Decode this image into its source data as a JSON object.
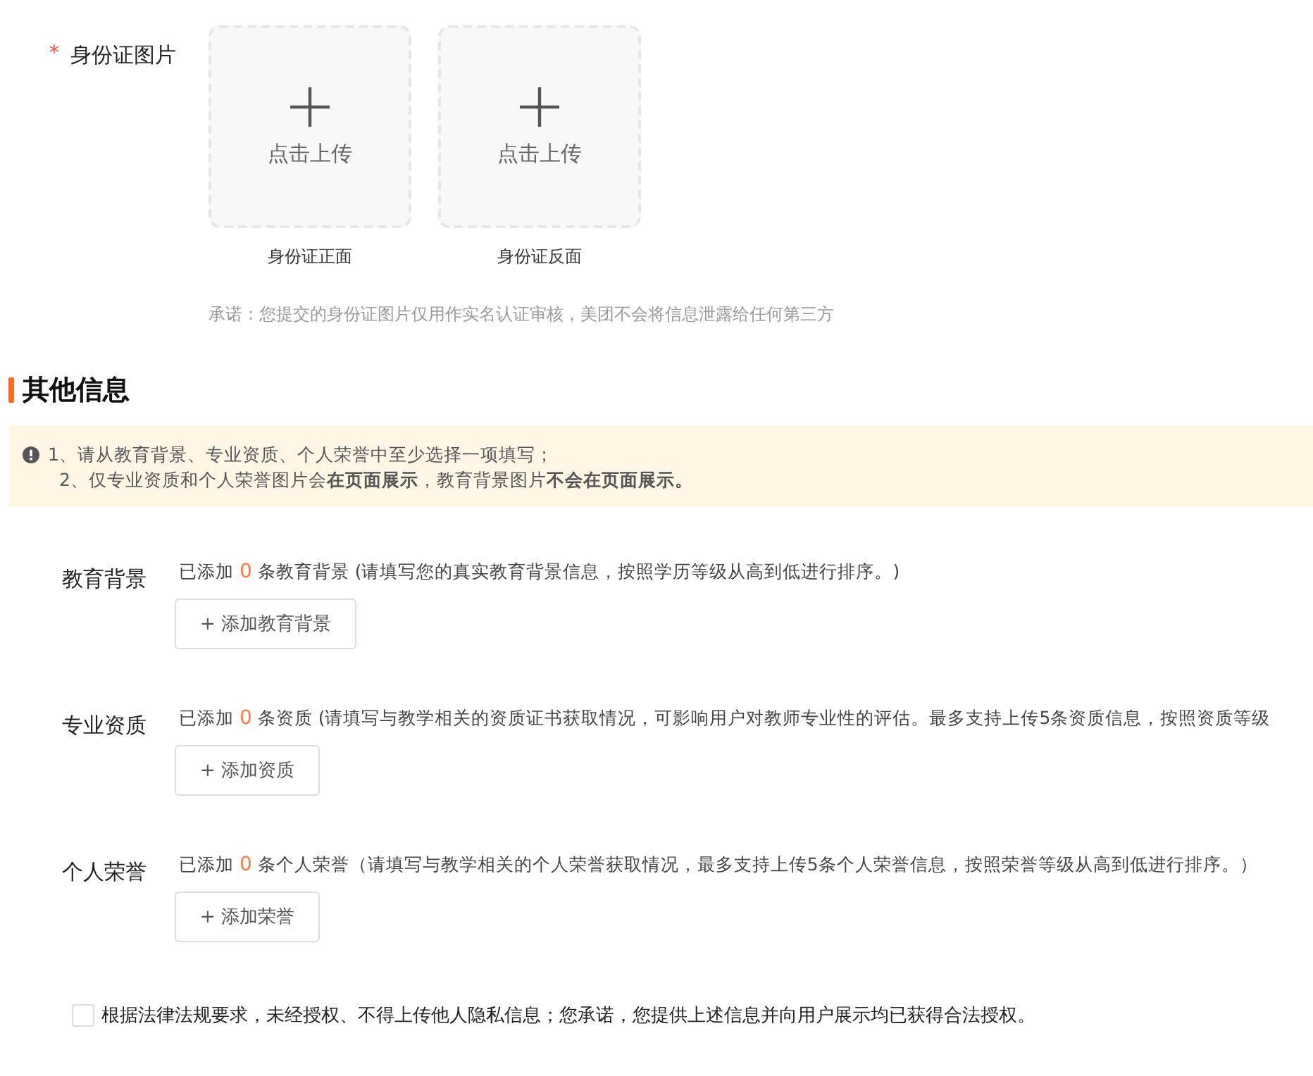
{
  "id_photo": {
    "required_mark": "*",
    "label": "身份证图片",
    "uploads": [
      {
        "text": "点击上传",
        "caption": "身份证正面"
      },
      {
        "text": "点击上传",
        "caption": "身份证反面"
      }
    ],
    "note": "承诺：您提交的身份证图片仅用作实名认证审核，美团不会将信息泄露给任何第三方"
  },
  "other_info": {
    "title": "其他信息",
    "alert": [
      "1、请从教育背景、专业资质、个人荣誉中至少选择一项填写；",
      "2、仅专业资质和个人荣誉图片会**在页面展示**，教育背景图片**不会在页面展示。**"
    ],
    "sections": [
      {
        "label": "教育背景",
        "prefix": "已添加",
        "count": "0",
        "suffix": "条教育背景 (请填写您的真实教育背景信息，按照学历等级从高到低进行排序。)",
        "button": "+ 添加教育背景"
      },
      {
        "label": "专业资质",
        "prefix": "已添加",
        "count": "0",
        "suffix": "条资质 (请填写与教学相关的资质证书获取情况，可影响用户对教师专业性的评估。最多支持上传5条资质信息，按照资质等级",
        "button": "+ 添加资质"
      },
      {
        "label": "个人荣誉",
        "prefix": "已添加",
        "count": "0",
        "suffix": "条个人荣誉（请填写与教学相关的个人荣誉获取情况，最多支持上传5条个人荣誉信息，按照荣誉等级从高到低进行排序。）",
        "button": "+ 添加荣誉"
      }
    ],
    "agreement": {
      "checked": false,
      "text": "根据法律法规要求，未经授权、不得上传他人隐私信息；您承诺，您提供上述信息并向用户展示均已获得合法授权。"
    }
  }
}
